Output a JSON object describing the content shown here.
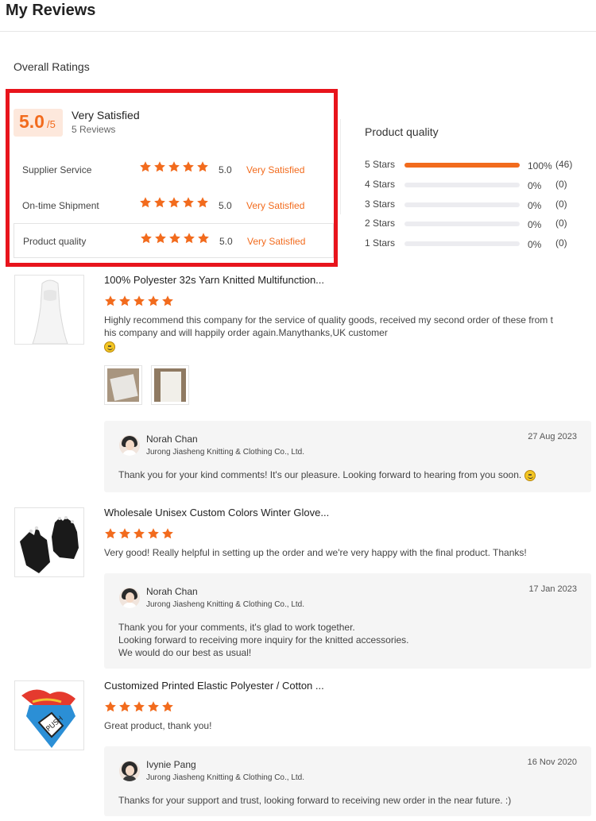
{
  "page": {
    "title": "My Reviews"
  },
  "overall": {
    "label": "Overall Ratings",
    "score": "5.0",
    "score_suffix": "/5",
    "satisfaction": "Very Satisfied",
    "review_count": "5 Reviews",
    "ratings": [
      {
        "label": "Supplier Service",
        "stars": 5,
        "score": "5.0",
        "satisfaction": "Very Satisfied"
      },
      {
        "label": "On-time Shipment",
        "stars": 5,
        "score": "5.0",
        "satisfaction": "Very Satisfied"
      },
      {
        "label": "Product quality",
        "stars": 5,
        "score": "5.0",
        "satisfaction": "Very Satisfied"
      }
    ]
  },
  "distribution": {
    "title": "Product quality",
    "rows": [
      {
        "label": "5 Stars",
        "fraction": 1.0,
        "percent": "100%",
        "count": "(46)"
      },
      {
        "label": "4 Stars",
        "fraction": 0,
        "percent": "0%",
        "count": "(0)"
      },
      {
        "label": "3 Stars",
        "fraction": 0,
        "percent": "0%",
        "count": "(0)"
      },
      {
        "label": "2 Stars",
        "fraction": 0,
        "percent": "0%",
        "count": "(0)"
      },
      {
        "label": "1 Stars",
        "fraction": 0,
        "percent": "0%",
        "count": "(0)"
      }
    ]
  },
  "reviews": [
    {
      "product": "100% Polyester 32s Yarn Knitted Multifunction...",
      "stars": 5,
      "text_line1": "Highly recommend this company for the service of quality goods, received my second order of these from t",
      "text_line2": "his company and will happily order again.Manythanks,UK customer",
      "reply": {
        "name": "Norah Chan",
        "company": "Jurong Jiasheng Knitting & Clothing Co., Ltd.",
        "date": "27 Aug 2023",
        "text": "Thank you for your kind comments! It's our pleasure. Looking forward to hearing from you soon."
      }
    },
    {
      "product": "Wholesale Unisex Custom Colors Winter Glove...",
      "stars": 5,
      "text": "Very good! Really helpful in setting up the order and we're very happy with the final product. Thanks!",
      "reply": {
        "name": "Norah Chan",
        "company": "Jurong Jiasheng Knitting & Clothing Co., Ltd.",
        "date": "17 Jan 2023",
        "line1": "Thank you for your comments, it's glad to work together.",
        "line2": "Looking forward to receiving more inquiry for the knitted accessories.",
        "line3": "We would do our best as usual!"
      }
    },
    {
      "product": "Customized Printed Elastic Polyester / Cotton ...",
      "stars": 5,
      "text": "Great product, thank you!",
      "reply": {
        "name": "Ivynie Pang",
        "company": "Jurong Jiasheng Knitting & Clothing Co., Ltd.",
        "date": "16 Nov 2020",
        "text": "Thanks for your support and trust, looking forward to receiving new order in the near future. :)"
      }
    }
  ],
  "colors": {
    "accent": "#f26b1d",
    "highlight_border": "#e8141c",
    "badge_bg": "#fde8dc"
  },
  "icons": {
    "star": "star-icon",
    "emoji": "smiley-emoji-icon"
  }
}
